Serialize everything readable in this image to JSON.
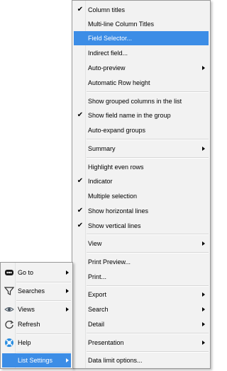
{
  "colors": {
    "highlight": "#3c8de6",
    "menu_bg": "#f2f2f2",
    "border": "#999999"
  },
  "main_menu": {
    "items": [
      {
        "label": "Go to",
        "icon": "goto-icon"
      },
      {
        "label": "Searches",
        "icon": "filter-funnel-icon"
      },
      {
        "label": "Views",
        "icon": "eye-views-icon"
      },
      {
        "label": "Refresh",
        "icon": "refresh-icon"
      },
      {
        "label": "Help",
        "icon": "help-lifebuoy-icon"
      },
      {
        "label": "List Settings",
        "icon": "none"
      }
    ]
  },
  "sub_menu": {
    "items": [
      {
        "label": "Column titles",
        "checked": true
      },
      {
        "label": "Multi-line Column Titles",
        "checked": false
      },
      {
        "label": "Field Selector...",
        "checked": false,
        "highlighted": true
      },
      {
        "label": "Indirect field...",
        "checked": false
      },
      {
        "label": "Auto-preview",
        "checked": false,
        "submenu": true
      },
      {
        "label": "Automatic Row height",
        "checked": false
      },
      {
        "label": "Show grouped columns in the list",
        "checked": false
      },
      {
        "label": "Show field name in the group",
        "checked": true
      },
      {
        "label": "Auto-expand groups",
        "checked": false
      },
      {
        "label": "Summary",
        "checked": false,
        "submenu": true
      },
      {
        "label": "Highlight even rows",
        "checked": false
      },
      {
        "label": "Indicator",
        "checked": true
      },
      {
        "label": "Multiple selection",
        "checked": false
      },
      {
        "label": "Show horizontal lines",
        "checked": true
      },
      {
        "label": "Show vertical lines",
        "checked": true
      },
      {
        "label": "View",
        "checked": false,
        "submenu": true
      },
      {
        "label": "Print Preview...",
        "checked": false
      },
      {
        "label": "Print...",
        "checked": false
      },
      {
        "label": "Export",
        "checked": false,
        "submenu": true
      },
      {
        "label": "Search",
        "checked": false,
        "submenu": true
      },
      {
        "label": "Detail",
        "checked": false,
        "submenu": true
      },
      {
        "label": "Presentation",
        "checked": false,
        "submenu": true
      },
      {
        "label": "Data limit options...",
        "checked": false
      }
    ]
  },
  "check_glyph": "✔"
}
